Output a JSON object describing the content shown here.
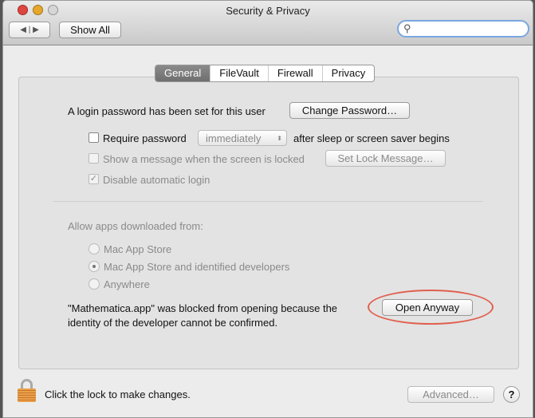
{
  "window": {
    "title": "Security & Privacy"
  },
  "toolbar": {
    "show_all": "Show All",
    "search_placeholder": ""
  },
  "tabs": [
    {
      "label": "General",
      "selected": true
    },
    {
      "label": "FileVault"
    },
    {
      "label": "Firewall"
    },
    {
      "label": "Privacy"
    }
  ],
  "general": {
    "login_text": "A login password has been set for this user",
    "change_password": "Change Password…",
    "require_password": "Require password",
    "require_password_checked": false,
    "require_delay": "immediately",
    "after_sleep": "after sleep or screen saver begins",
    "show_message": "Show a message when the screen is locked",
    "set_lock_message": "Set Lock Message…",
    "disable_auto_login": "Disable automatic login",
    "disable_auto_login_checked": true,
    "allow_apps_label": "Allow apps downloaded from:",
    "options": [
      {
        "label": "Mac App Store",
        "selected": false
      },
      {
        "label": "Mac App Store and identified developers",
        "selected": true
      },
      {
        "label": "Anywhere",
        "selected": false
      }
    ],
    "blocked_line1": "\"Mathematica.app\" was blocked from opening because the",
    "blocked_line2": "identity of the developer cannot be confirmed.",
    "open_anyway": "Open Anyway"
  },
  "footer": {
    "lock_text": "Click the lock to make changes.",
    "advanced": "Advanced…",
    "help": "?"
  },
  "colors": {
    "highlight_oval": "#e0604f",
    "close": "#e0443e",
    "minimize": "#e6a82a",
    "zoom_disabled": "#cfcfcf"
  }
}
